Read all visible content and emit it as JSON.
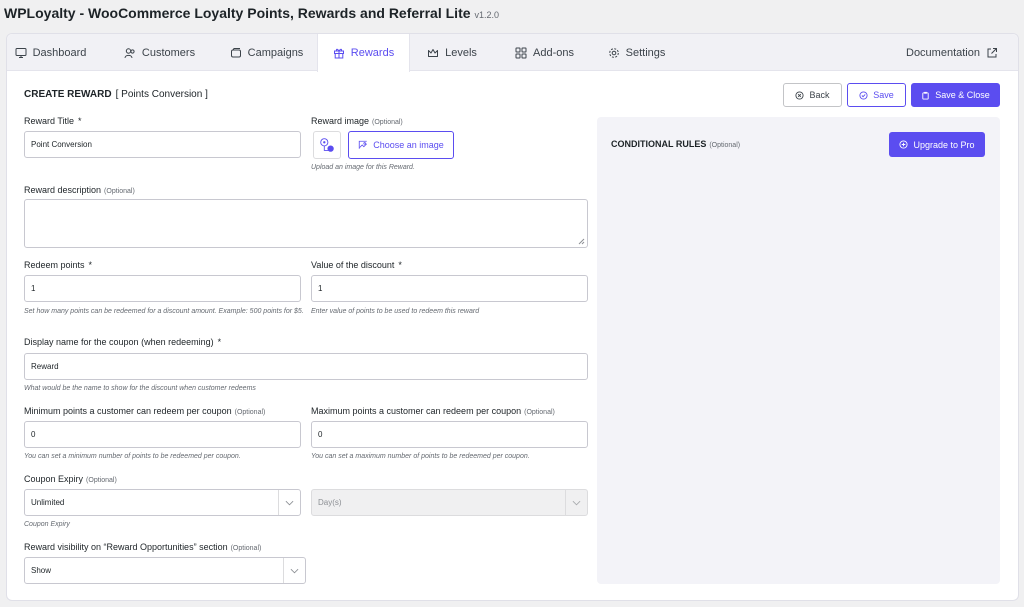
{
  "app": {
    "title": "WPLoyalty - WooCommerce Loyalty Points, Rewards and Referral Lite",
    "version": "v1.2.0"
  },
  "tabs": [
    {
      "label": "Dashboard",
      "icon": "dashboard-icon",
      "active": false
    },
    {
      "label": "Customers",
      "icon": "customers-icon",
      "active": false
    },
    {
      "label": "Campaigns",
      "icon": "campaigns-icon",
      "active": false
    },
    {
      "label": "Rewards",
      "icon": "gift-icon",
      "active": true
    },
    {
      "label": "Levels",
      "icon": "crown-icon",
      "active": false
    },
    {
      "label": "Add-ons",
      "icon": "grid-icon",
      "active": false
    },
    {
      "label": "Settings",
      "icon": "gear-icon",
      "active": false
    }
  ],
  "documentation": {
    "label": "Documentation",
    "icon": "external-link-icon"
  },
  "page": {
    "heading": "CREATE REWARD",
    "subheading": "[ Points Conversion ]"
  },
  "toolbar": {
    "back_label": "Back",
    "save_label": "Save",
    "save_close_label": "Save & Close"
  },
  "form": {
    "reward_title": {
      "label": "Reward Title",
      "required": "*",
      "value": "Point Conversion"
    },
    "reward_image": {
      "label": "Reward image",
      "optional": "(Optional)",
      "button": "Choose an image",
      "hint": "Upload an image for this Reward."
    },
    "reward_description": {
      "label": "Reward description",
      "optional": "(Optional)",
      "value": ""
    },
    "redeem_points": {
      "label": "Redeem points",
      "required": "*",
      "value": "1",
      "hint": "Set how many points can be redeemed for a discount amount. Example: 500 points for $5."
    },
    "discount_value": {
      "label": "Value of the discount",
      "required": "*",
      "value": "1",
      "hint": "Enter value of points to be used to redeem this reward"
    },
    "coupon_display_name": {
      "label": "Display name for the coupon (when redeeming)",
      "required": "*",
      "value": "Reward",
      "hint": "What would be the name to show for the discount when customer redeems"
    },
    "min_points": {
      "label": "Minimum points a customer can redeem per coupon",
      "optional": "(Optional)",
      "value": "0",
      "hint": "You can set a minimum number of points to be redeemed per coupon."
    },
    "max_points": {
      "label": "Maximum points a customer can redeem per coupon",
      "optional": "(Optional)",
      "value": "0",
      "hint": "You can set a maximum number of points to be redeemed per coupon."
    },
    "coupon_expiry": {
      "label": "Coupon Expiry",
      "optional": "(Optional)",
      "value": "Unlimited",
      "unit_value": "Day(s)",
      "hint": "Coupon Expiry"
    },
    "visibility": {
      "label": "Reward visibility on “Reward Opportunities” section",
      "optional": "(Optional)",
      "value": "Show"
    }
  },
  "rules": {
    "title": "CONDITIONAL RULES",
    "optional": "(Optional)",
    "upgrade_label": "Upgrade to Pro"
  },
  "colors": {
    "accent": "#5b4df0",
    "panel": "#f3f3f8"
  }
}
